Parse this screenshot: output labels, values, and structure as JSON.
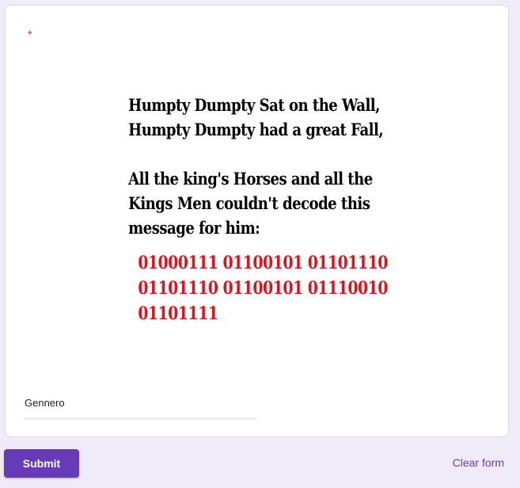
{
  "question": {
    "required_marker": "*",
    "image": {
      "poem_lines": [
        "Humpty Dumpty Sat on the Wall,",
        "Humpty Dumpty had a great Fall,",
        "",
        "All the king's Horses and all the",
        "Kings Men couldn't decode this",
        "message for him:"
      ],
      "binary_lines": [
        "01000111 01100101 01101110",
        "01101110 01100101 01110010",
        "01101111"
      ]
    },
    "answer_value": "Gennero"
  },
  "footer": {
    "submit_label": "Submit",
    "clear_label": "Clear form"
  },
  "colors": {
    "accent": "#673ab7",
    "background": "#f0ebf8",
    "required": "#d93025",
    "binary_text": "#e0121b"
  }
}
